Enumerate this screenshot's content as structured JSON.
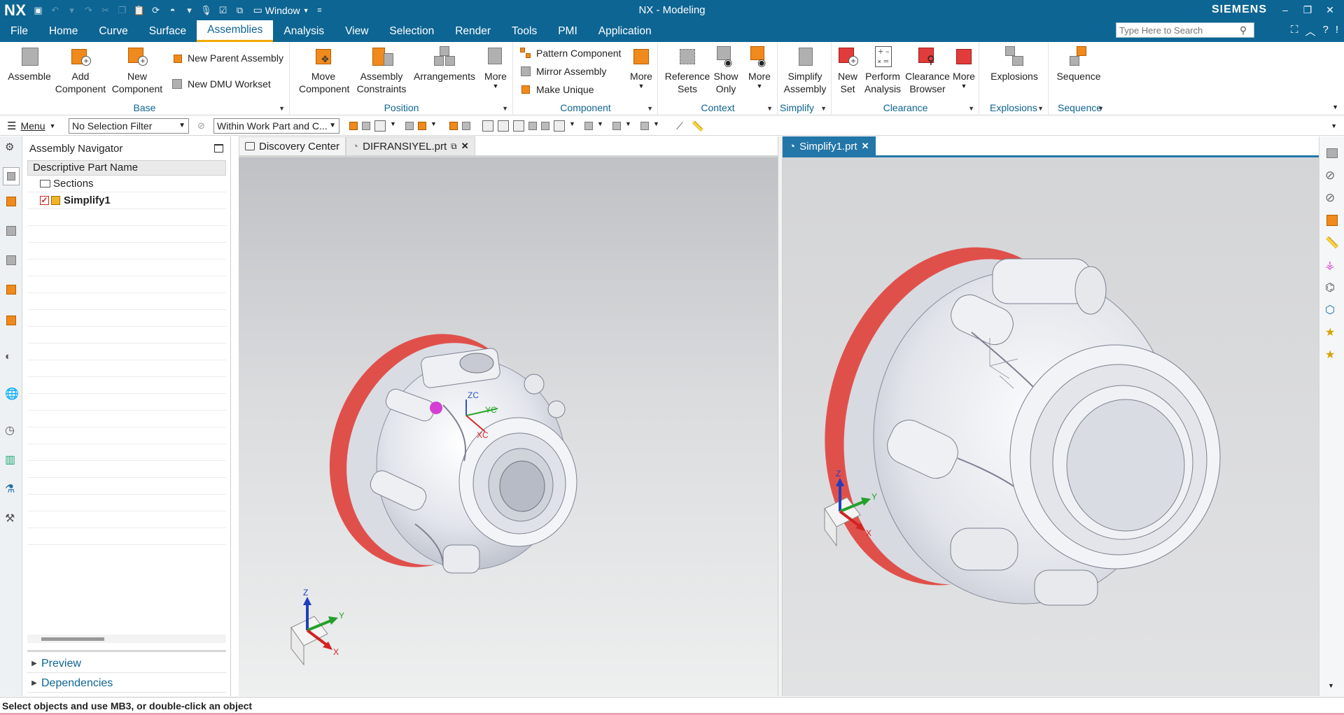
{
  "app": {
    "logo": "NX",
    "title": "NX - Modeling",
    "brand": "SIEMENS",
    "window_menu": "Window"
  },
  "menu_tabs": [
    "File",
    "Home",
    "Curve",
    "Surface",
    "Assemblies",
    "Analysis",
    "View",
    "Selection",
    "Render",
    "Tools",
    "PMI",
    "Application"
  ],
  "active_tab": "Assemblies",
  "search": {
    "placeholder": "Type Here to Search"
  },
  "ribbon": {
    "base": {
      "label": "Base",
      "assemble": "Assemble",
      "add_component": [
        "Add",
        "Component"
      ],
      "new_component": [
        "New",
        "Component"
      ],
      "new_parent_assembly": "New Parent Assembly",
      "new_dmu_workset": "New DMU Workset"
    },
    "position": {
      "label": "Position",
      "move_component": [
        "Move",
        "Component"
      ],
      "assembly_constraints": [
        "Assembly",
        "Constraints"
      ],
      "arrangements": "Arrangements",
      "more": "More"
    },
    "component": {
      "label": "Component",
      "pattern_component": "Pattern Component",
      "mirror_assembly": "Mirror Assembly",
      "make_unique": "Make Unique",
      "more": "More"
    },
    "context": {
      "label": "Context",
      "reference_sets": [
        "Reference",
        "Sets"
      ],
      "show_only": [
        "Show",
        "Only"
      ],
      "more": "More"
    },
    "simplify": {
      "label": "Simplify",
      "simplify_assembly": [
        "Simplify",
        "Assembly"
      ]
    },
    "clearance": {
      "label": "Clearance",
      "new_set": [
        "New",
        "Set"
      ],
      "perform_analysis": [
        "Perform",
        "Analysis"
      ],
      "clearance_browser": [
        "Clearance",
        "Browser"
      ],
      "more": "More"
    },
    "explosions": {
      "label": "Explosions",
      "button": "Explosions"
    },
    "sequence": {
      "label": "Sequence",
      "button": "Sequence"
    }
  },
  "toolbar": {
    "menu_label": "Menu",
    "selection_filter": "No Selection Filter",
    "selection_scope": "Within Work Part and C..."
  },
  "navigator": {
    "title": "Assembly Navigator",
    "column_header": "Descriptive Part Name",
    "rows": [
      {
        "label": "Sections"
      },
      {
        "label": "Simplify1"
      }
    ],
    "preview": "Preview",
    "dependencies": "Dependencies"
  },
  "doc_tabs": {
    "left": [
      "Discovery Center",
      "DIFRANSIYEL.prt"
    ],
    "right": "Simplify1.prt"
  },
  "triad": {
    "z": "Z",
    "y": "Y",
    "x": "X"
  },
  "wcs": {
    "zc": "ZC",
    "yc": "YC",
    "xc": "XC"
  },
  "status": "Select objects and use MB3, or double-click an object",
  "colors": {
    "chrome_blue": "#0d6593",
    "active_tab_underline": "#f2a900",
    "group_label": "#0d6593",
    "part_red": "#e0504b",
    "part_body": "#dfe2e8"
  }
}
